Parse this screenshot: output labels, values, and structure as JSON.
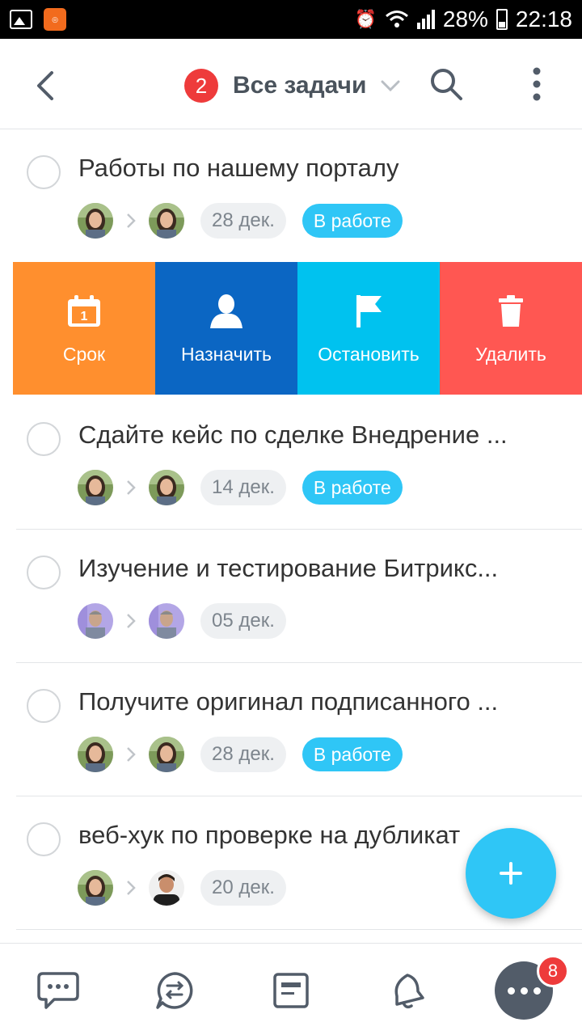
{
  "status_bar": {
    "battery": "28%",
    "time": "22:18"
  },
  "header": {
    "count": "2",
    "title": "Все задачи"
  },
  "tasks": [
    {
      "title": "Работы по нашему порталу",
      "date": "28 дек.",
      "status": "В работе",
      "from_avatar": "girl",
      "to_avatar": "girl"
    },
    {
      "title": "Сдайте кейс по сделке Внедрение ...",
      "date": "14 дек.",
      "status": "В работе",
      "from_avatar": "girl",
      "to_avatar": "girl"
    },
    {
      "title": "Изучение и тестирование Битрикс...",
      "date": "05 дек.",
      "status": "",
      "from_avatar": "man",
      "to_avatar": "man"
    },
    {
      "title": "Получите оригинал подписанного ...",
      "date": "28 дек.",
      "status": "В работе",
      "from_avatar": "girl",
      "to_avatar": "girl"
    },
    {
      "title": "веб-хук по проверке на дубликат",
      "date": "20 дек.",
      "status": "",
      "from_avatar": "girl",
      "to_avatar": "dark"
    }
  ],
  "swipe_actions": [
    {
      "label": "Срок",
      "icon": "calendar-icon",
      "color": "#ff8f2e",
      "day": "1"
    },
    {
      "label": "Назначить",
      "icon": "person-icon",
      "color": "#0b66c3"
    },
    {
      "label": "Остановить",
      "icon": "flag-icon",
      "color": "#00c2ef"
    },
    {
      "label": "Удалить",
      "icon": "trash-icon",
      "color": "#ff5752"
    }
  ],
  "fab": {
    "icon": "plus-icon"
  },
  "bottom_nav": {
    "items": [
      "chat-icon",
      "channels-icon",
      "news-icon",
      "notifications-icon"
    ],
    "more_badge": "8"
  },
  "colors": {
    "accent": "#2fc6f6",
    "badge": "#ee3b3b"
  }
}
